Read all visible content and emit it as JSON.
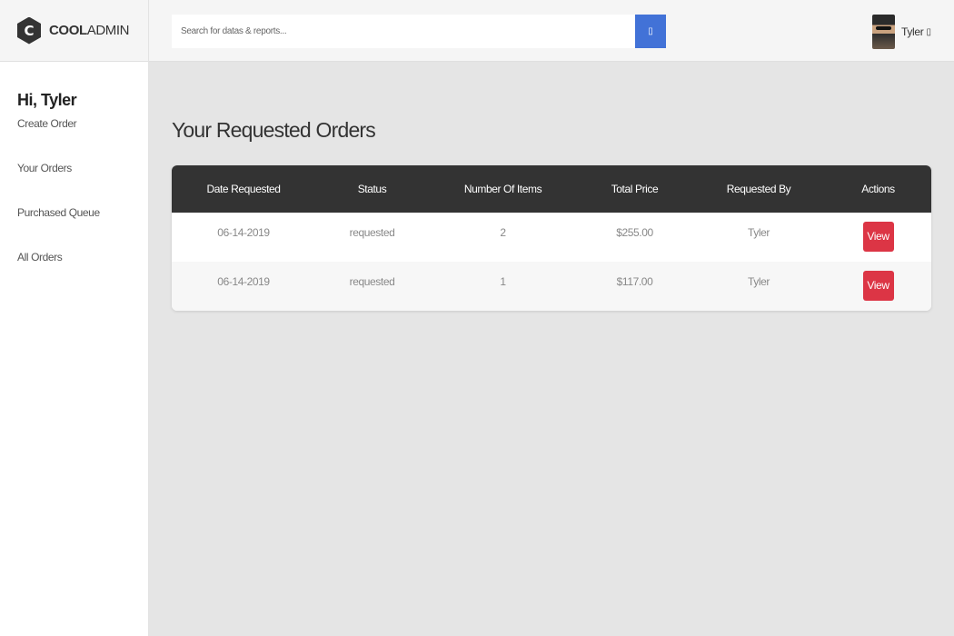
{
  "brand": {
    "logo_letter": "C",
    "name_bold": "COOL",
    "name_light": "ADMIN"
  },
  "search": {
    "placeholder": "Search for datas & reports...",
    "button_icon": "search-icon",
    "button_glyph": "▯"
  },
  "user": {
    "name": "Tyler",
    "caret": "▯"
  },
  "sidebar": {
    "greeting": "Hi, Tyler",
    "items": [
      {
        "label": "Create Order"
      },
      {
        "label": "Your Orders"
      },
      {
        "label": "Purchased Queue"
      },
      {
        "label": "All Orders"
      }
    ]
  },
  "main": {
    "title": "Your Requested Orders",
    "table": {
      "headers": [
        "Date Requested",
        "Status",
        "Number Of Items",
        "Total Price",
        "Requested By",
        "Actions"
      ],
      "rows": [
        {
          "date": "06-14-2019",
          "status": "requested",
          "items": "2",
          "price": "$255.00",
          "by": "Tyler",
          "action": "View"
        },
        {
          "date": "06-14-2019",
          "status": "requested",
          "items": "1",
          "price": "$117.00",
          "by": "Tyler",
          "action": "View"
        }
      ]
    }
  },
  "colors": {
    "header_bar": "#333333",
    "search_button": "#4272d7",
    "view_button": "#dc3545",
    "background": "#e5e5e5"
  }
}
